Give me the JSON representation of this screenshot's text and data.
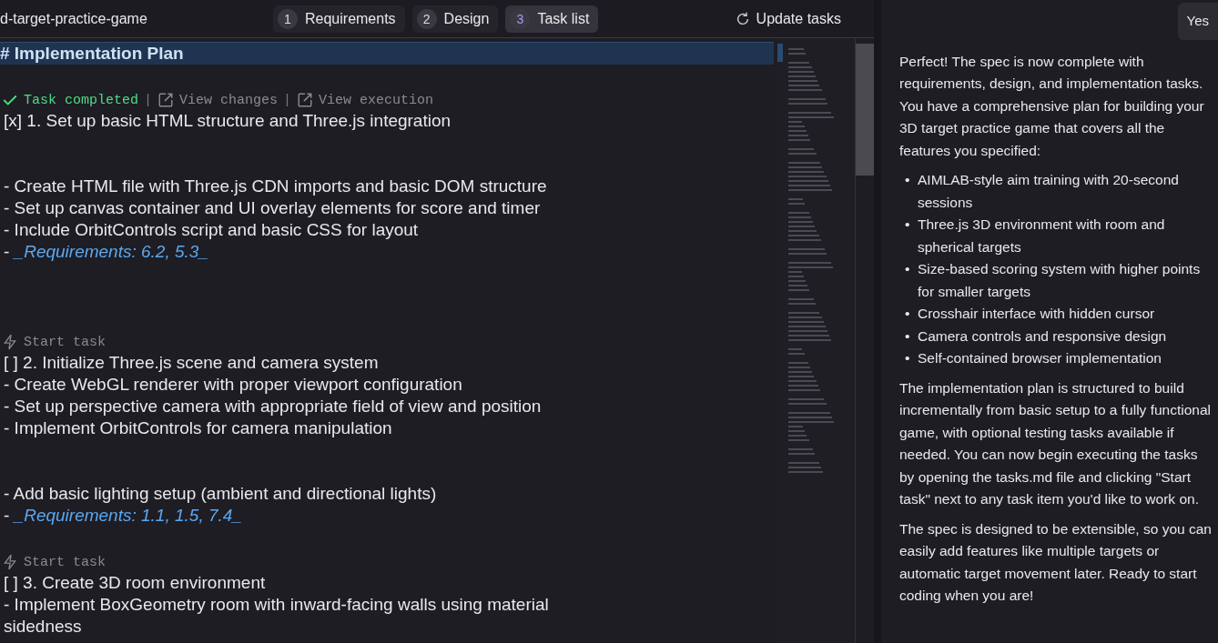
{
  "header": {
    "title": "d-target-practice-game",
    "steps": [
      {
        "number": "1",
        "label": "Requirements",
        "selected": false
      },
      {
        "number": "2",
        "label": "Design",
        "selected": false
      },
      {
        "number": "3",
        "label": "Task list",
        "selected": true
      }
    ],
    "action": "Update tasks"
  },
  "editor": {
    "lines": [
      {
        "kind": "heading",
        "text": "# Implementation Plan"
      },
      {
        "kind": "blank"
      },
      {
        "kind": "lens",
        "items": [
          {
            "kind": "status",
            "completed": true,
            "text": "Task completed"
          },
          {
            "kind": "sep",
            "text": "|"
          },
          {
            "kind": "view",
            "completed": false,
            "text": "View changes"
          },
          {
            "kind": "sep",
            "text": "|"
          },
          {
            "kind": "view",
            "completed": false,
            "text": "View execution"
          }
        ]
      },
      {
        "kind": "text",
        "text": "[x] 1. Set up basic HTML structure and Three.js integration"
      },
      {
        "kind": "blank"
      },
      {
        "kind": "blank"
      },
      {
        "kind": "text",
        "text": "- Create HTML file with Three.js CDN imports and basic DOM structure"
      },
      {
        "kind": "text",
        "text": "- Set up canvas container and UI overlay elements for score and timer"
      },
      {
        "kind": "text",
        "text": "- Include OrbitControls script and basic CSS for layout"
      },
      {
        "kind": "req",
        "prefix": "- ",
        "text": "_Requirements: 6.2, 5.3_"
      },
      {
        "kind": "blank"
      },
      {
        "kind": "blank"
      },
      {
        "kind": "blank"
      },
      {
        "kind": "lens",
        "items": [
          {
            "kind": "start",
            "completed": false,
            "text": "Start task"
          }
        ]
      },
      {
        "kind": "text",
        "text": "[ ] 2. Initialize Three.js scene and camera system"
      },
      {
        "kind": "text",
        "text": "- Create WebGL renderer with proper viewport configuration"
      },
      {
        "kind": "text",
        "text": "- Set up perspective camera with appropriate field of view and position"
      },
      {
        "kind": "text",
        "text": "- Implement OrbitControls for camera manipulation"
      },
      {
        "kind": "blank"
      },
      {
        "kind": "blank"
      },
      {
        "kind": "text",
        "text": "- Add basic lighting setup (ambient and directional lights)"
      },
      {
        "kind": "req",
        "prefix": "- ",
        "text": "_Requirements: 1.1, 1.5, 7.4_"
      },
      {
        "kind": "blank"
      },
      {
        "kind": "lens",
        "items": [
          {
            "kind": "start",
            "completed": false,
            "text": "Start task"
          }
        ]
      },
      {
        "kind": "text",
        "text": "[ ] 3. Create 3D room environment"
      },
      {
        "kind": "text",
        "text": "- Implement BoxGeometry room with inward-facing walls using material sidedness"
      }
    ]
  },
  "chat": {
    "user_message": "Yes",
    "blocks": [
      {
        "kind": "paragraph",
        "text": "Perfect! The spec is now complete with requirements, design, and implementation tasks. You have a comprehensive plan for building your 3D target practice game that covers all the features you specified:"
      },
      {
        "kind": "list",
        "marker": "•",
        "items": [
          "AIMLAB-style aim training with 20-second sessions",
          "Three.js 3D environment with room and spherical targets",
          "Size-based scoring system with higher points for smaller targets",
          "Crosshair interface with hidden cursor",
          "Camera controls and responsive design",
          "Self-contained browser implementation"
        ]
      },
      {
        "kind": "paragraph",
        "text": "The implementation plan is structured to build incrementally from basic setup to a fully functional game, with optional testing tasks available if needed. You can now begin executing the tasks by opening the tasks.md file and clicking \"Start task\" next to any task item you'd like to work on."
      },
      {
        "kind": "paragraph",
        "text": "The spec is designed to be extensible, so you can easily add features like multiple targets or automatic target movement later. Ready to start coding when you are!"
      }
    ]
  }
}
